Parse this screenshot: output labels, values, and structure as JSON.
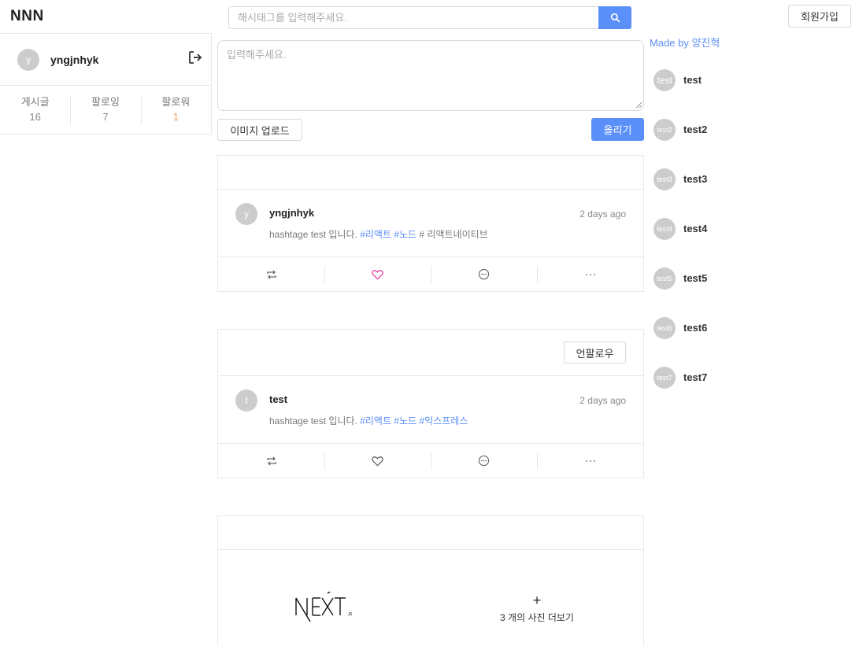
{
  "header": {
    "logo": "NNN",
    "search_placeholder": "해시태그를 입력해주세요.",
    "signup_label": "회원가입"
  },
  "profile": {
    "avatar_initial": "y",
    "username": "yngjnhyk",
    "stats": [
      {
        "label": "게시글",
        "value": "16"
      },
      {
        "label": "팔로잉",
        "value": "7"
      },
      {
        "label": "팔로워",
        "value": "1"
      }
    ]
  },
  "composer": {
    "placeholder": "입력해주세요.",
    "image_upload_label": "이미지 업로드",
    "post_label": "올리기"
  },
  "posts": [
    {
      "avatar_initial": "y",
      "author": "yngjnhyk",
      "time": "2 days ago",
      "text_prefix": "hashtage test 입니다. ",
      "tags": [
        "#리액트",
        "#노드"
      ],
      "text_suffix": " # 리액트네이티브",
      "liked": true
    },
    {
      "unfollow_label": "언팔로우",
      "avatar_initial": "t",
      "author": "test",
      "time": "2 days ago",
      "text_prefix": "hashtage test 입니다. ",
      "tags": [
        "#리액트",
        "#노드",
        "#익스프레스"
      ],
      "liked": false
    }
  ],
  "image_post": {
    "more_photos_plus": "+",
    "more_photos_label": "3 개의 사진 더보기"
  },
  "sidebar": {
    "made_by": "Made by 양진혁",
    "users": [
      {
        "avatar": "test",
        "name": "test"
      },
      {
        "avatar": "test2",
        "name": "test2"
      },
      {
        "avatar": "test3",
        "name": "test3"
      },
      {
        "avatar": "test4",
        "name": "test4"
      },
      {
        "avatar": "test5",
        "name": "test5"
      },
      {
        "avatar": "test6",
        "name": "test6"
      },
      {
        "avatar": "test7",
        "name": "test7"
      }
    ]
  },
  "colors": {
    "primary": "#5b8ff9",
    "like": "#eb2f96",
    "follower_count": "#e8a25a"
  },
  "icons": {
    "search": "search-icon",
    "logout": "logout-icon",
    "retweet": "retweet-icon",
    "heart": "heart-icon",
    "comment": "comment-icon",
    "more": "ellipsis-icon"
  }
}
